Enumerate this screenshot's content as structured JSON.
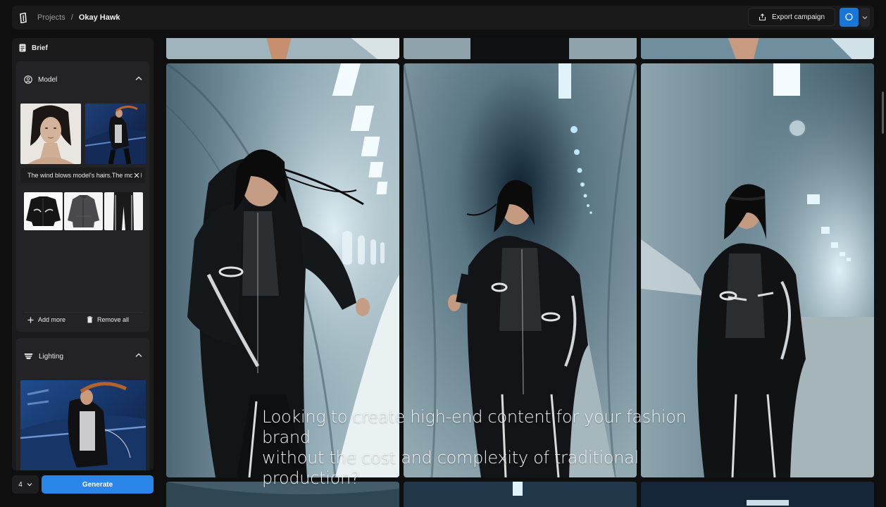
{
  "breadcrumb": {
    "projects": "Projects",
    "separator": "/",
    "current": "Okay Hawk"
  },
  "header": {
    "export_label": "Export campaign",
    "avatar_initial": "O"
  },
  "sidebar": {
    "brief_title": "Brief",
    "model_section": {
      "title": "Model",
      "prompt": "The wind blows model's hairs.The model",
      "add_more": "Add more",
      "remove_all": "Remove all"
    },
    "lighting_section": {
      "title": "Lighting"
    }
  },
  "footer": {
    "count_value": "4",
    "generate_label": "Generate"
  },
  "caption": {
    "line1": "Looking to create high-end content for your fashion brand",
    "line2": "without the cost and complexity of traditional production?"
  },
  "colors": {
    "accent": "#2a86e8",
    "avatar": "#1877d6",
    "panel": "#1b1b1c",
    "background": "#0f0f10"
  }
}
